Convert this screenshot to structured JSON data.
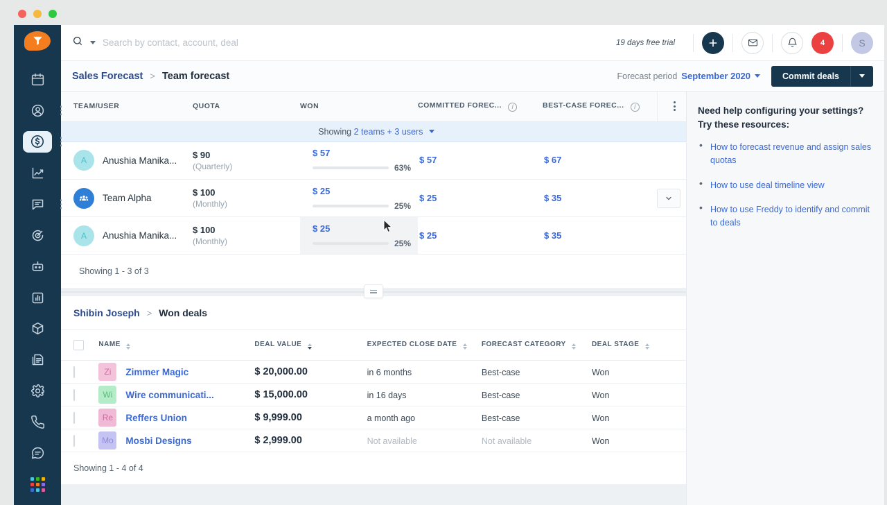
{
  "window": {
    "dots": [
      "close",
      "minimize",
      "maximize"
    ]
  },
  "topbar": {
    "search_placeholder": "Search by contact, account, deal",
    "search_value": "",
    "trial_text": "19 days free trial",
    "notification_count": "4",
    "avatar_initial": "S"
  },
  "breadcrumb": {
    "parent": "Sales Forecast",
    "separator": ">",
    "current": "Team forecast",
    "forecast_period_label": "Forecast period",
    "forecast_period_value": "September 2020",
    "commit_button": "Commit deals"
  },
  "forecast_table": {
    "columns": [
      {
        "label": "TEAM/USER",
        "info": false
      },
      {
        "label": "QUOTA",
        "info": false
      },
      {
        "label": "WON",
        "info": false
      },
      {
        "label": "COMMITTED FOREC...",
        "info": true
      },
      {
        "label": "BEST-CASE FOREC...",
        "info": true
      }
    ],
    "showing_banner": {
      "prefix": "Showing",
      "link": "2 teams + 3 users"
    },
    "rows": [
      {
        "avatar_initial": "A",
        "avatar_type": "user",
        "name": "Anushia Manika...",
        "quota": "$ 90",
        "quota_period": "(Quarterly)",
        "won": "$ 57",
        "won_pct": "63%",
        "won_pct_num": 63,
        "committed": "$ 57",
        "best_case": "$ 67",
        "expandable": false
      },
      {
        "avatar_initial": "",
        "avatar_type": "team",
        "name": "Team Alpha",
        "quota": "$ 100",
        "quota_period": "(Monthly)",
        "won": "$ 25",
        "won_pct": "25%",
        "won_pct_num": 25,
        "committed": "$ 25",
        "best_case": "$ 35",
        "expandable": true
      },
      {
        "avatar_initial": "A",
        "avatar_type": "user",
        "name": "Anushia Manika...",
        "quota": "$ 100",
        "quota_period": "(Monthly)",
        "won": "$ 25",
        "won_pct": "25%",
        "won_pct_num": 25,
        "committed": "$ 25",
        "best_case": "$ 35",
        "expandable": false
      }
    ],
    "footer": "Showing 1 - 3 of 3"
  },
  "deals_panel": {
    "crumb_parent": "Shibin Joseph",
    "crumb_sep": ">",
    "crumb_current": "Won deals",
    "columns": [
      {
        "label": "NAME",
        "sorted": false
      },
      {
        "label": "DEAL VALUE",
        "sorted": true
      },
      {
        "label": "EXPECTED CLOSE DATE",
        "sorted": false
      },
      {
        "label": "FORECAST CATEGORY",
        "sorted": false
      },
      {
        "label": "DEAL STAGE",
        "sorted": false
      }
    ],
    "rows": [
      {
        "initials": "Zi",
        "color": "pink",
        "name": "Zimmer Magic",
        "value": "$ 20,000.00",
        "close": "in 6 months",
        "close_muted": false,
        "category": "Best-case",
        "category_muted": false,
        "stage": "Won"
      },
      {
        "initials": "Wi",
        "color": "green",
        "name": "Wire communicati...",
        "value": "$ 15,000.00",
        "close": "in 16 days",
        "close_muted": false,
        "category": "Best-case",
        "category_muted": false,
        "stage": "Won"
      },
      {
        "initials": "Re",
        "color": "pink",
        "name": "Reffers Union",
        "value": "$ 9,999.00",
        "close": "a month ago",
        "close_muted": false,
        "category": "Best-case",
        "category_muted": false,
        "stage": "Won"
      },
      {
        "initials": "Mo",
        "color": "purple",
        "name": "Mosbi Designs",
        "value": "$ 2,999.00",
        "close": "Not available",
        "close_muted": true,
        "category": "Not available",
        "category_muted": true,
        "stage": "Won"
      }
    ],
    "footer": "Showing 1 - 4 of 4"
  },
  "help_panel": {
    "title": "Need help configuring your settings? Try these resources:",
    "links": [
      "How to forecast revenue and assign sales quotas",
      "How to use deal timeline view",
      "How to use Freddy to identify and commit to deals"
    ]
  },
  "sidebar": {
    "logo": "freshworks-logo",
    "items": [
      {
        "icon": "calendar-icon",
        "active": false,
        "dots": false
      },
      {
        "icon": "contacts-icon",
        "active": false,
        "dots": true
      },
      {
        "icon": "deals-icon",
        "active": true,
        "dots": true
      },
      {
        "icon": "reports-icon",
        "active": false,
        "dots": false
      },
      {
        "icon": "chat-icon",
        "active": false,
        "dots": true
      },
      {
        "icon": "target-icon",
        "active": false,
        "dots": false
      },
      {
        "icon": "bot-icon",
        "active": false,
        "dots": false
      },
      {
        "icon": "analytics-icon",
        "active": false,
        "dots": false
      },
      {
        "icon": "products-icon",
        "active": false,
        "dots": false
      },
      {
        "icon": "documents-icon",
        "active": false,
        "dots": false
      },
      {
        "icon": "settings-icon",
        "active": false,
        "dots": false
      }
    ],
    "bottom_items": [
      {
        "icon": "phone-icon"
      },
      {
        "icon": "message-icon"
      },
      {
        "icon": "apps-grid-icon"
      }
    ]
  },
  "colors": {
    "nav_bg": "#17374f",
    "accent_orange": "#f47d20",
    "link_blue": "#3b69d4",
    "progress_green": "#3fb618",
    "badge_red": "#ec4141",
    "dark_navy": "#17374f"
  }
}
